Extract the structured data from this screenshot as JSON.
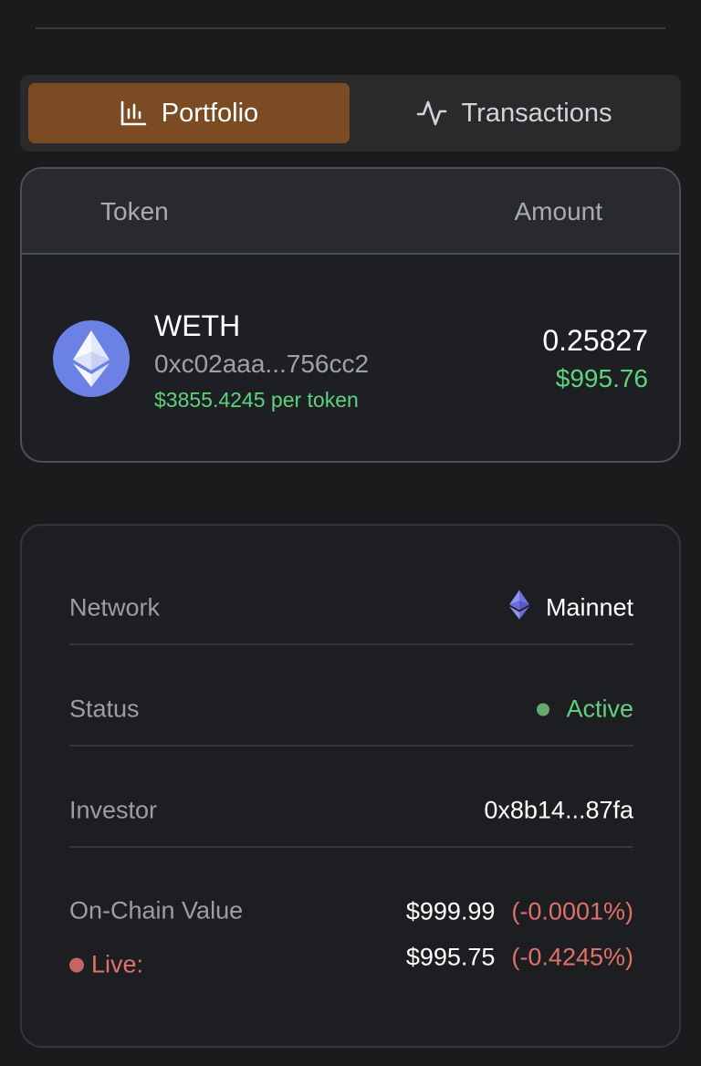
{
  "tabs": {
    "portfolio": {
      "label": "Portfolio",
      "icon": "bar-chart-icon",
      "active": true,
      "active_color": "#7b4b24"
    },
    "transactions": {
      "label": "Transactions",
      "icon": "activity-icon"
    }
  },
  "token_table": {
    "headers": {
      "token": "Token",
      "amount": "Amount"
    },
    "rows": [
      {
        "symbol": "WETH",
        "address": "0xc02aaa...756cc2",
        "price": "$3855.4245 per token",
        "amount": "0.25827",
        "value": "$995.76",
        "icon": "ethereum-icon"
      }
    ]
  },
  "info": {
    "network": {
      "label": "Network",
      "value": "Mainnet",
      "icon": "ethereum-icon"
    },
    "status": {
      "label": "Status",
      "value": "Active",
      "color": "#62d07c"
    },
    "investor": {
      "label": "Investor",
      "value": "0x8b14...87fa"
    },
    "valuation": {
      "onchain_label": "On-Chain Value",
      "live_label": "Live:",
      "onchain_value": "$999.99",
      "onchain_change": "(-0.0001%)",
      "live_value": "$995.75",
      "live_change": "(-0.4245%)"
    }
  }
}
